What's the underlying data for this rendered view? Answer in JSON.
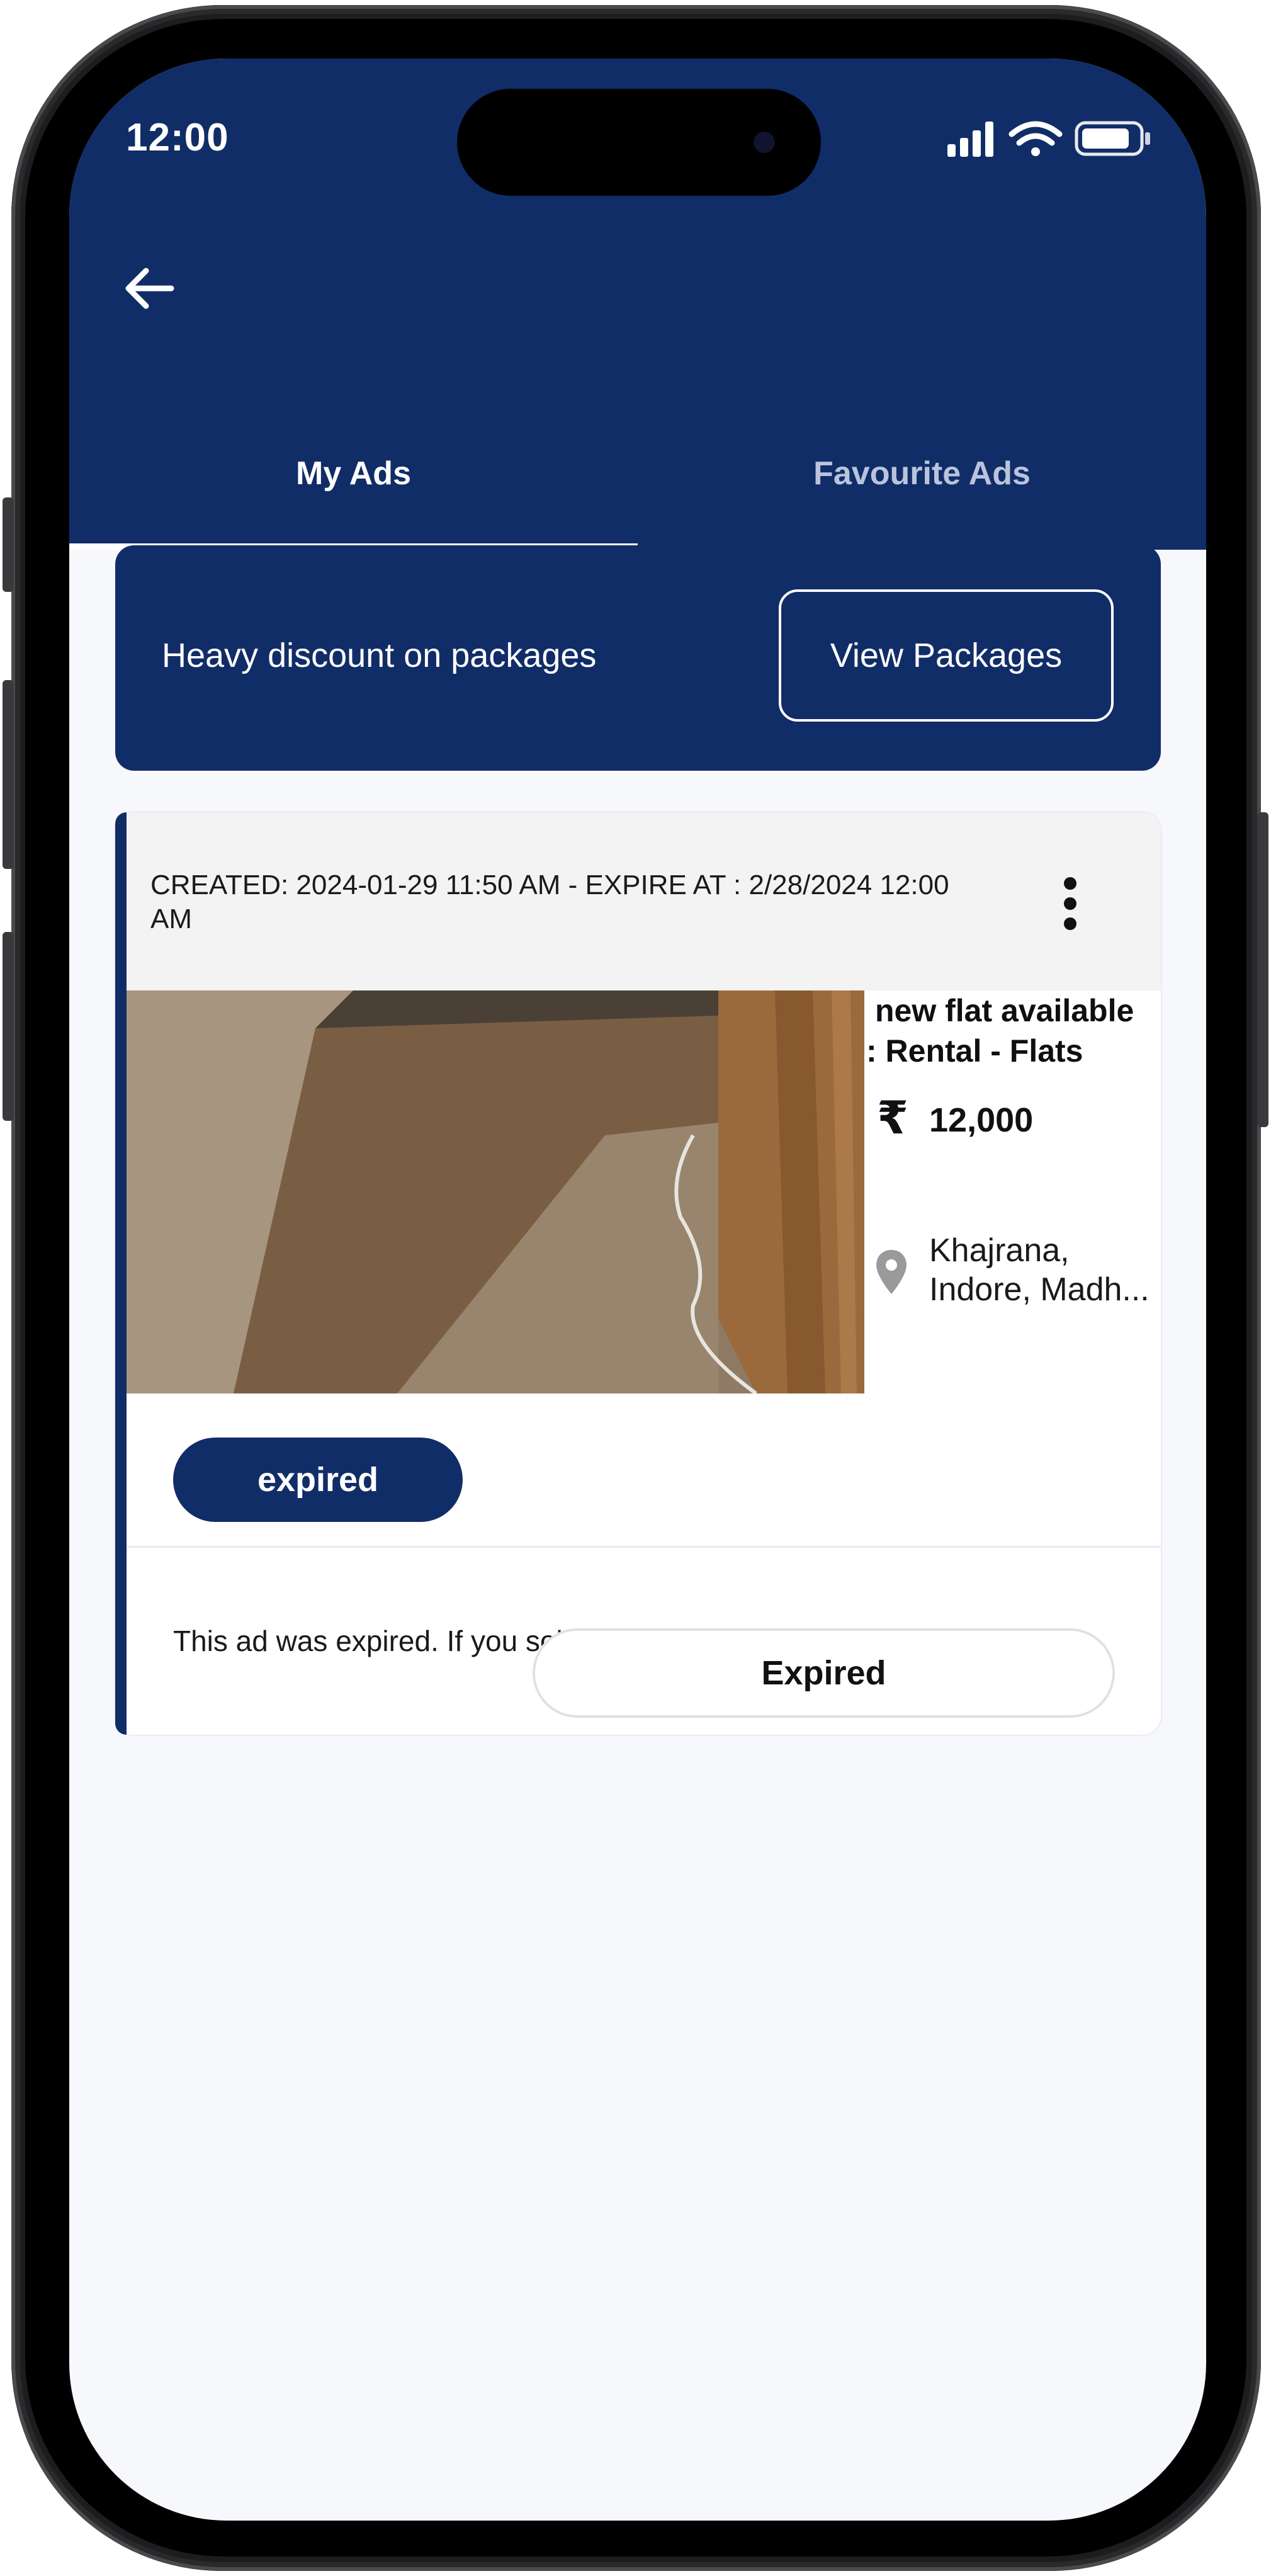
{
  "status_bar": {
    "time": "12:00"
  },
  "tabs": [
    {
      "label": "My Ads",
      "active": true
    },
    {
      "label": "Favourite Ads",
      "active": false
    }
  ],
  "promo": {
    "text": "Heavy discount on packages",
    "button_label": "View Packages"
  },
  "ad": {
    "created_line": "CREATED: 2024-01-29 11:50 AM - EXPIRE AT : 2/28/2024 12:00 AM",
    "title_line1": "new flat available",
    "title_line2": ": Rental - Flats",
    "currency_symbol": "₹",
    "price": "12,000",
    "location_line1": "Khajrana,",
    "location_line2": "Indore, Madh...",
    "status": "expired",
    "notice": "This ad was expired. If you sold it, please mark it as sold",
    "action_label": "Expired"
  },
  "colors": {
    "primary": "#112d67",
    "background": "#f7f8fc",
    "card_header": "#f3f3f3",
    "inactive_tab": "#b9c4dc"
  }
}
